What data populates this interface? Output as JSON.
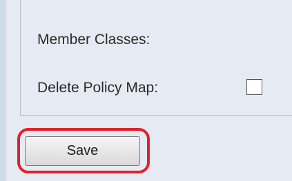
{
  "form": {
    "member_classes_label": "Member Classes:",
    "delete_policy_map_label": "Delete Policy Map:",
    "delete_policy_map_checked": false
  },
  "actions": {
    "save_label": "Save"
  },
  "colors": {
    "page_background": "#e6ebf3",
    "highlight": "#e2202b"
  }
}
